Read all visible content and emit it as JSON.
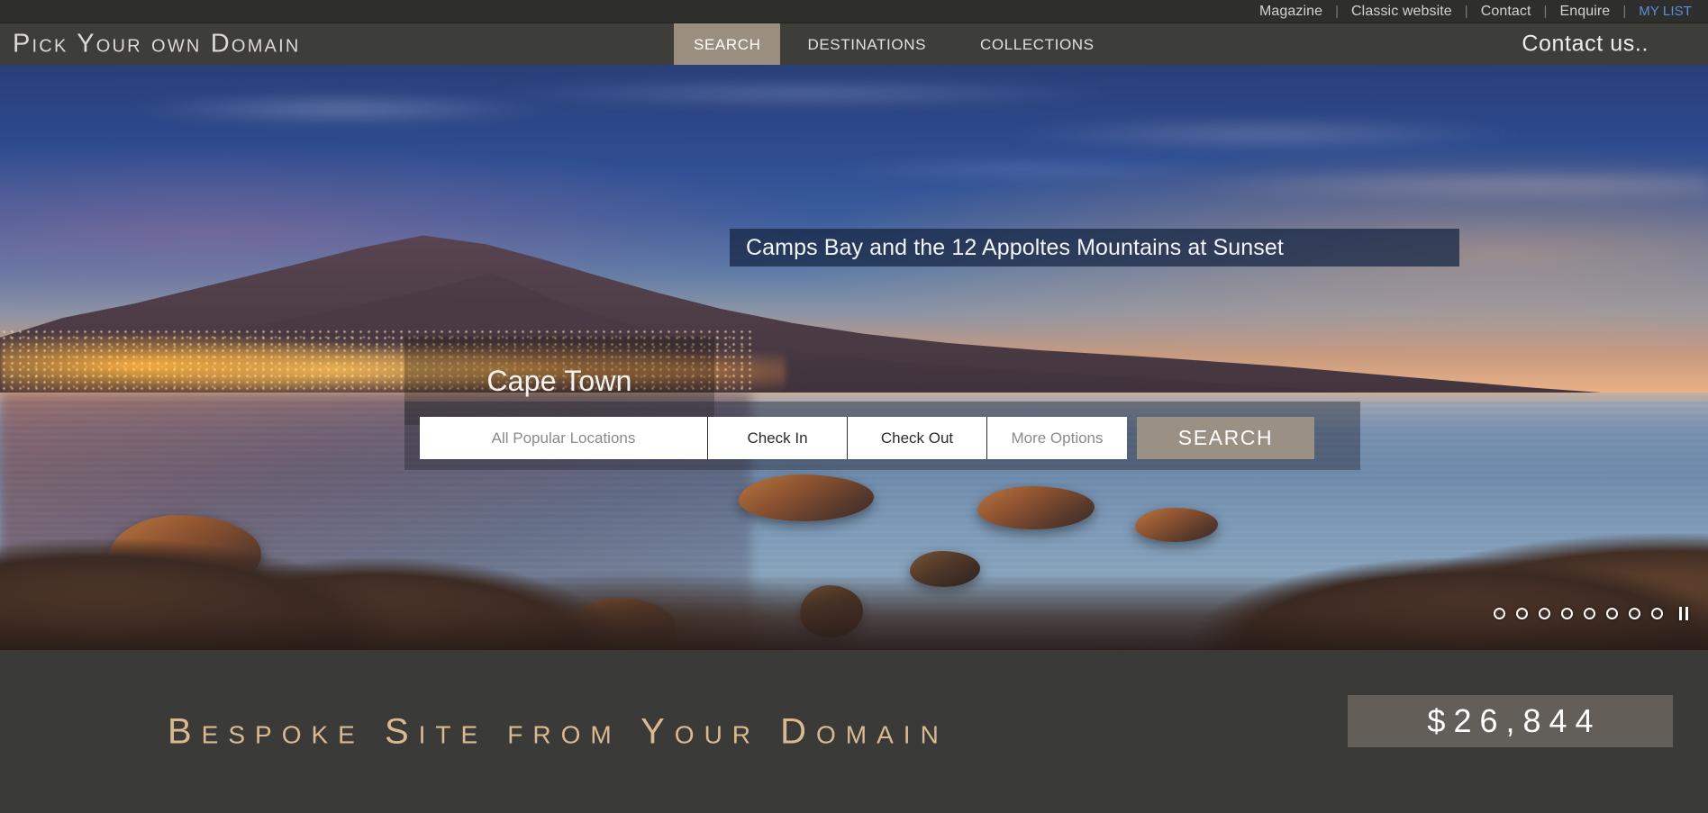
{
  "topbar": {
    "links": [
      {
        "label": "Magazine",
        "accent": false
      },
      {
        "label": "Classic website",
        "accent": false
      },
      {
        "label": "Contact",
        "accent": false
      },
      {
        "label": "Enquire",
        "accent": false
      },
      {
        "label": "MY LIST",
        "accent": true
      }
    ],
    "separator": "|",
    "accent_color": "#5e8fd6"
  },
  "header": {
    "brand": "Pick Your own Domain",
    "nav": [
      {
        "label": "SEARCH",
        "active": true
      },
      {
        "label": "DESTINATIONS",
        "active": false
      },
      {
        "label": "COLLECTIONS",
        "active": false
      }
    ],
    "contact_label": "Contact us..",
    "active_tab_color": "#9a8f7f",
    "bar_color": "#3d3d3a"
  },
  "hero": {
    "caption": "Camps Bay and the 12 Appoltes Mountains at Sunset",
    "place_name": "Cape Town",
    "caption_bg": "#162644",
    "search": {
      "location_value": "All Popular Locations",
      "checkin_label": "Check In",
      "checkout_label": "Check Out",
      "more_options_label": "More Options",
      "search_button": "SEARCH",
      "button_color": "#9a9083"
    },
    "carousel": {
      "dot_count": 8,
      "active_index": 0,
      "pause_icon": "pause-icon"
    }
  },
  "footer": {
    "tagline": "Bespoke Site from Your Domain",
    "price": "$26,844",
    "tagline_color": "#dab98f",
    "price_box_color": "#635e58",
    "background": "#3a3a38"
  }
}
